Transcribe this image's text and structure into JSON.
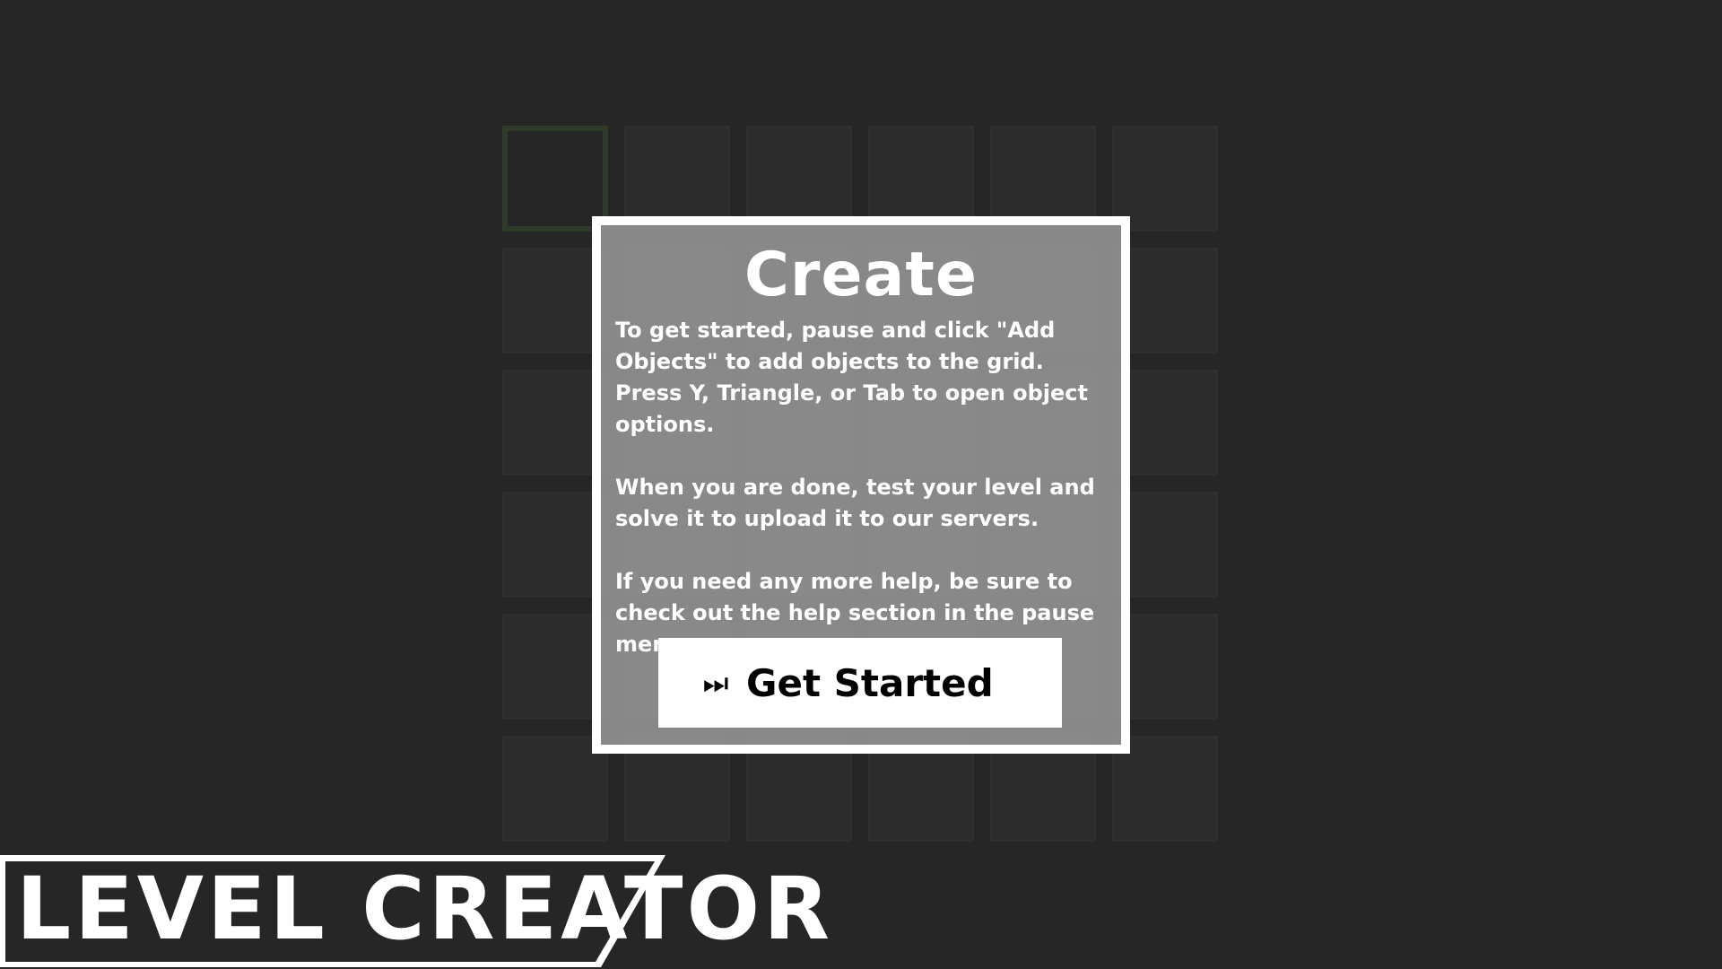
{
  "dialog": {
    "title": "Create",
    "paragraphs": [
      "To get started, pause and click \"Add Objects\" to add objects to the grid. Press Y, Triangle, or Tab to open object options.",
      "When you are done, test your level and solve it to upload it to our servers.",
      "If you need any more help, be sure to check out the help section in the pause menu."
    ],
    "button": {
      "icon": "fast-forward-icon",
      "glyph": "⏭",
      "label": "Get Started"
    }
  },
  "screen_title": "LEVEL CREATOR",
  "grid": {
    "rows": 6,
    "columns": 6,
    "selected_cell": [
      0,
      0
    ]
  },
  "colors": {
    "background": "#262626",
    "dialog_border": "#ffffff",
    "button_bg": "#ffffff",
    "selected_outline": "#2d3b28"
  }
}
